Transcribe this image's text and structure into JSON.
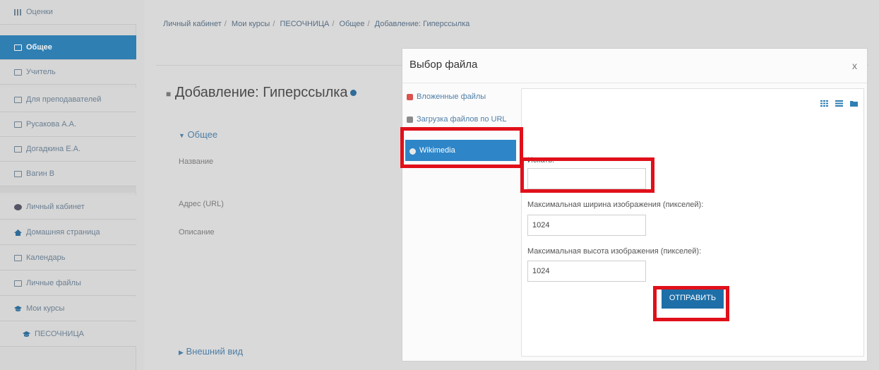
{
  "sidebar": {
    "items": [
      {
        "label": "Оценки",
        "icon": "grades-grid-icon"
      },
      {
        "label": "Общее",
        "icon": "folder-icon",
        "active": true
      },
      {
        "label": "Учитель",
        "icon": "folder-icon"
      },
      {
        "label": "Для преподавателей",
        "icon": "folder-icon"
      },
      {
        "label": "Русакова А.А.",
        "icon": "folder-icon"
      },
      {
        "label": "Догадкина Е.А.",
        "icon": "folder-icon"
      },
      {
        "label": "Вагин В",
        "icon": "folder-icon"
      }
    ],
    "nav": [
      {
        "label": "Личный кабинет",
        "icon": "dashboard-icon"
      },
      {
        "label": "Домашняя страница",
        "icon": "home-icon"
      },
      {
        "label": "Календарь",
        "icon": "calendar-icon"
      },
      {
        "label": "Личные файлы",
        "icon": "file-icon"
      },
      {
        "label": "Мои курсы",
        "icon": "graduation-cap-icon"
      },
      {
        "label": "ПЕСОЧНИЦА",
        "icon": "graduation-cap-icon"
      }
    ]
  },
  "breadcrumb": [
    "Личный кабинет",
    "Мои курсы",
    "ПЕСОЧНИЦА",
    "Общее",
    "Добавление: Гиперссылка"
  ],
  "page": {
    "title": "Добавление: Гиперссылка",
    "section_general": "Общее",
    "label_name": "Название",
    "label_url": "Адрес (URL)",
    "label_description": "Описание",
    "section_appearance": "Внешний вид"
  },
  "modal": {
    "title": "Выбор файла",
    "close": "x",
    "repositories": [
      {
        "label": "Вложенные файлы",
        "icon": "attached-files-icon"
      },
      {
        "label": "Загрузка файлов по URL",
        "icon": "url-download-icon"
      },
      {
        "label": "Wikimedia",
        "icon": "wikimedia-icon",
        "active": true
      }
    ],
    "search_label": "Искать:",
    "search_value": "",
    "max_width_label": "Максимальная ширина изображения (пикселей):",
    "max_width_value": "1024",
    "max_height_label": "Максимальная высота изображения (пикселей):",
    "max_height_value": "1024",
    "submit_label": "ОТПРАВИТЬ"
  },
  "colors": {
    "accent": "#2f7fb3",
    "highlight": "#e0101a",
    "button": "#1e6fa8"
  }
}
